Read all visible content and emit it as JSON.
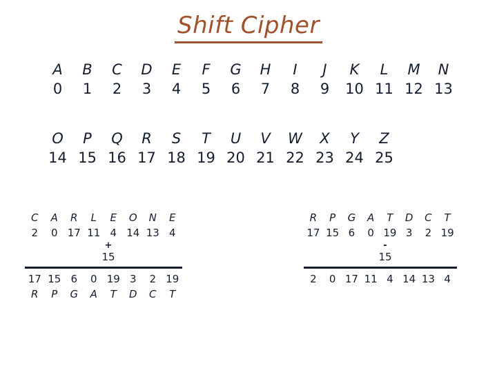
{
  "slide": {
    "title": "Shift Cipher",
    "title_color": "#A0522D",
    "body_color": "#141d2e",
    "background_color": "#ffffff"
  },
  "alphabet_table": {
    "row1": {
      "letters": [
        "A",
        "B",
        "C",
        "D",
        "E",
        "F",
        "G",
        "H",
        "I",
        "J",
        "K",
        "L",
        "M",
        "N"
      ],
      "numbers": [
        "0",
        "1",
        "2",
        "3",
        "4",
        "5",
        "6",
        "7",
        "8",
        "9",
        "10",
        "11",
        "12",
        "13"
      ]
    },
    "row2": {
      "letters": [
        "O",
        "P",
        "Q",
        "R",
        "S",
        "T",
        "U",
        "V",
        "W",
        "X",
        "Y",
        "Z"
      ],
      "numbers": [
        "14",
        "15",
        "16",
        "17",
        "18",
        "19",
        "20",
        "21",
        "22",
        "23",
        "24",
        "25"
      ]
    }
  },
  "examples": {
    "encrypt": {
      "plaintext_letters": [
        "C",
        "A",
        "R",
        "L",
        "E",
        "O",
        "N",
        "E"
      ],
      "plaintext_numbers": [
        "2",
        "0",
        "17",
        "11",
        "4",
        "14",
        "13",
        "4"
      ],
      "operator": "+",
      "key": "15",
      "result_numbers": [
        "17",
        "15",
        "6",
        "0",
        "19",
        "3",
        "2",
        "19"
      ],
      "result_letters": [
        "R",
        "P",
        "G",
        "A",
        "T",
        "D",
        "C",
        "T"
      ]
    },
    "decrypt": {
      "ciphertext_letters": [
        "R",
        "P",
        "G",
        "A",
        "T",
        "D",
        "C",
        "T"
      ],
      "ciphertext_numbers": [
        "17",
        "15",
        "6",
        "0",
        "19",
        "3",
        "2",
        "19"
      ],
      "operator": "-",
      "key": "15",
      "result_numbers": [
        "2",
        "0",
        "17",
        "11",
        "4",
        "14",
        "13",
        "4"
      ]
    }
  }
}
